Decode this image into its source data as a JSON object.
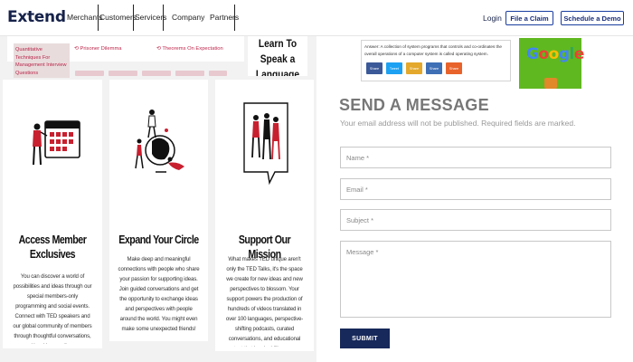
{
  "header": {
    "logo": "Extend",
    "nav": [
      "Merchants",
      "Customers",
      "Servicers",
      "Company",
      "Partners"
    ],
    "login": "Login",
    "file_claim": "File a Claim",
    "schedule_demo": "Schedule a Demo"
  },
  "article_strip": {
    "side_tag": "Quantitative Techniques For Management Interview Questions",
    "links": [
      "Prisoner Dilemma",
      "Theorems On Expectation"
    ],
    "language_box": "Learn To Speak a Language"
  },
  "cards": [
    {
      "title": "Access Member Exclusives",
      "body": "You can discover a world of possibilities and ideas through our special members-only programming and social events. Connect with TED speakers and our global community of members through thoughtful conversations, and inspiring small group discussions."
    },
    {
      "title": "Expand Your Circle",
      "body": "Make deep and meaningful connections with people who share your passion for supporting ideas. Join guided conversations and get the opportunity to exchange ideas and perspectives with people around the world. You might even make some unexpected friends!"
    },
    {
      "title": "Support Our Mission",
      "body": "What makes TED unique aren't only the TED Talks, it's the space we create for new ideas and new perspectives to blossom. Your support powers the production of hundreds of videos translated in over 100 languages, perspective-shifting podcasts, curated conversations, and educational content that inspire billions across the globe."
    }
  ],
  "answer": {
    "label": "Answer:",
    "text": "A collection of system programs that controls and co-ordinates the overall operations of a computer system is called operating system.",
    "share": [
      {
        "label": "Share",
        "color": "#3b5998"
      },
      {
        "label": "Tweet",
        "color": "#1da1f2"
      },
      {
        "label": "Share",
        "color": "#e3a82c"
      },
      {
        "label": "Share",
        "color": "#3f6fb5"
      },
      {
        "label": "Share",
        "color": "#e8632b"
      }
    ]
  },
  "ad": {
    "text": "Google"
  },
  "form": {
    "title": "SEND A MESSAGE",
    "note": "Your email address will not be published. Required fields are marked.",
    "name_placeholder": "Name *",
    "email_placeholder": "Email *",
    "subject_placeholder": "Subject *",
    "message_placeholder": "Message *",
    "submit": "SUBMIT"
  },
  "colors": {
    "brand_navy": "#16224a",
    "button_blue": "#1a3ea0",
    "submit_navy": "#17285a",
    "accent_red": "#c8202f"
  }
}
